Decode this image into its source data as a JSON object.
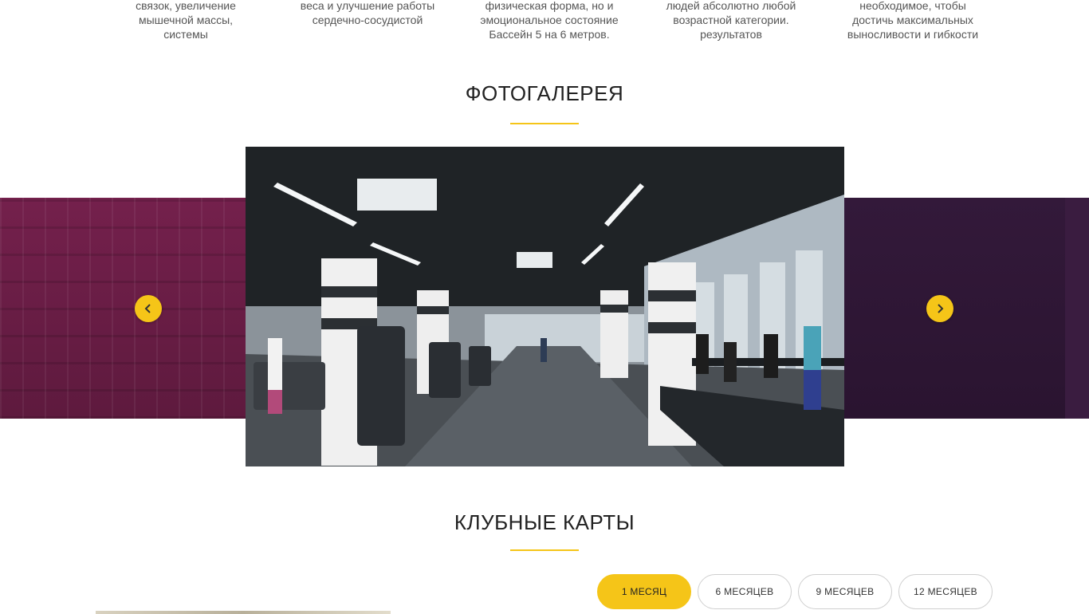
{
  "features": [
    {
      "lines": [
        "связок, увеличение",
        "мышечной массы,",
        "системы"
      ]
    },
    {
      "lines": [
        "веса и улучшение работы",
        "сердечно-сосудистой",
        ""
      ]
    },
    {
      "lines": [
        "физическая форма, но и",
        "эмоциональное состояние",
        "Бассейн 5 на 6 метров."
      ]
    },
    {
      "lines": [
        "людей абсолютно любой",
        "возрастной категории.",
        "результатов"
      ]
    },
    {
      "lines": [
        "необходимое, чтобы",
        "достичь максимальных",
        "выносливости и гибкости"
      ]
    }
  ],
  "gallery": {
    "title": "ФОТОГАЛЕРЕЯ",
    "accent_color": "#f5c518",
    "prev_icon": "chevron-left-icon",
    "next_icon": "chevron-right-icon"
  },
  "club_cards": {
    "title": "КЛУБНЫЕ КАРТЫ",
    "tabs": [
      {
        "label": "1 МЕСЯЦ",
        "active": true
      },
      {
        "label": "6 МЕСЯЦЕВ",
        "active": false
      },
      {
        "label": "9 МЕСЯЦЕВ",
        "active": false
      },
      {
        "label": "12 МЕСЯЦЕВ",
        "active": false
      }
    ]
  }
}
